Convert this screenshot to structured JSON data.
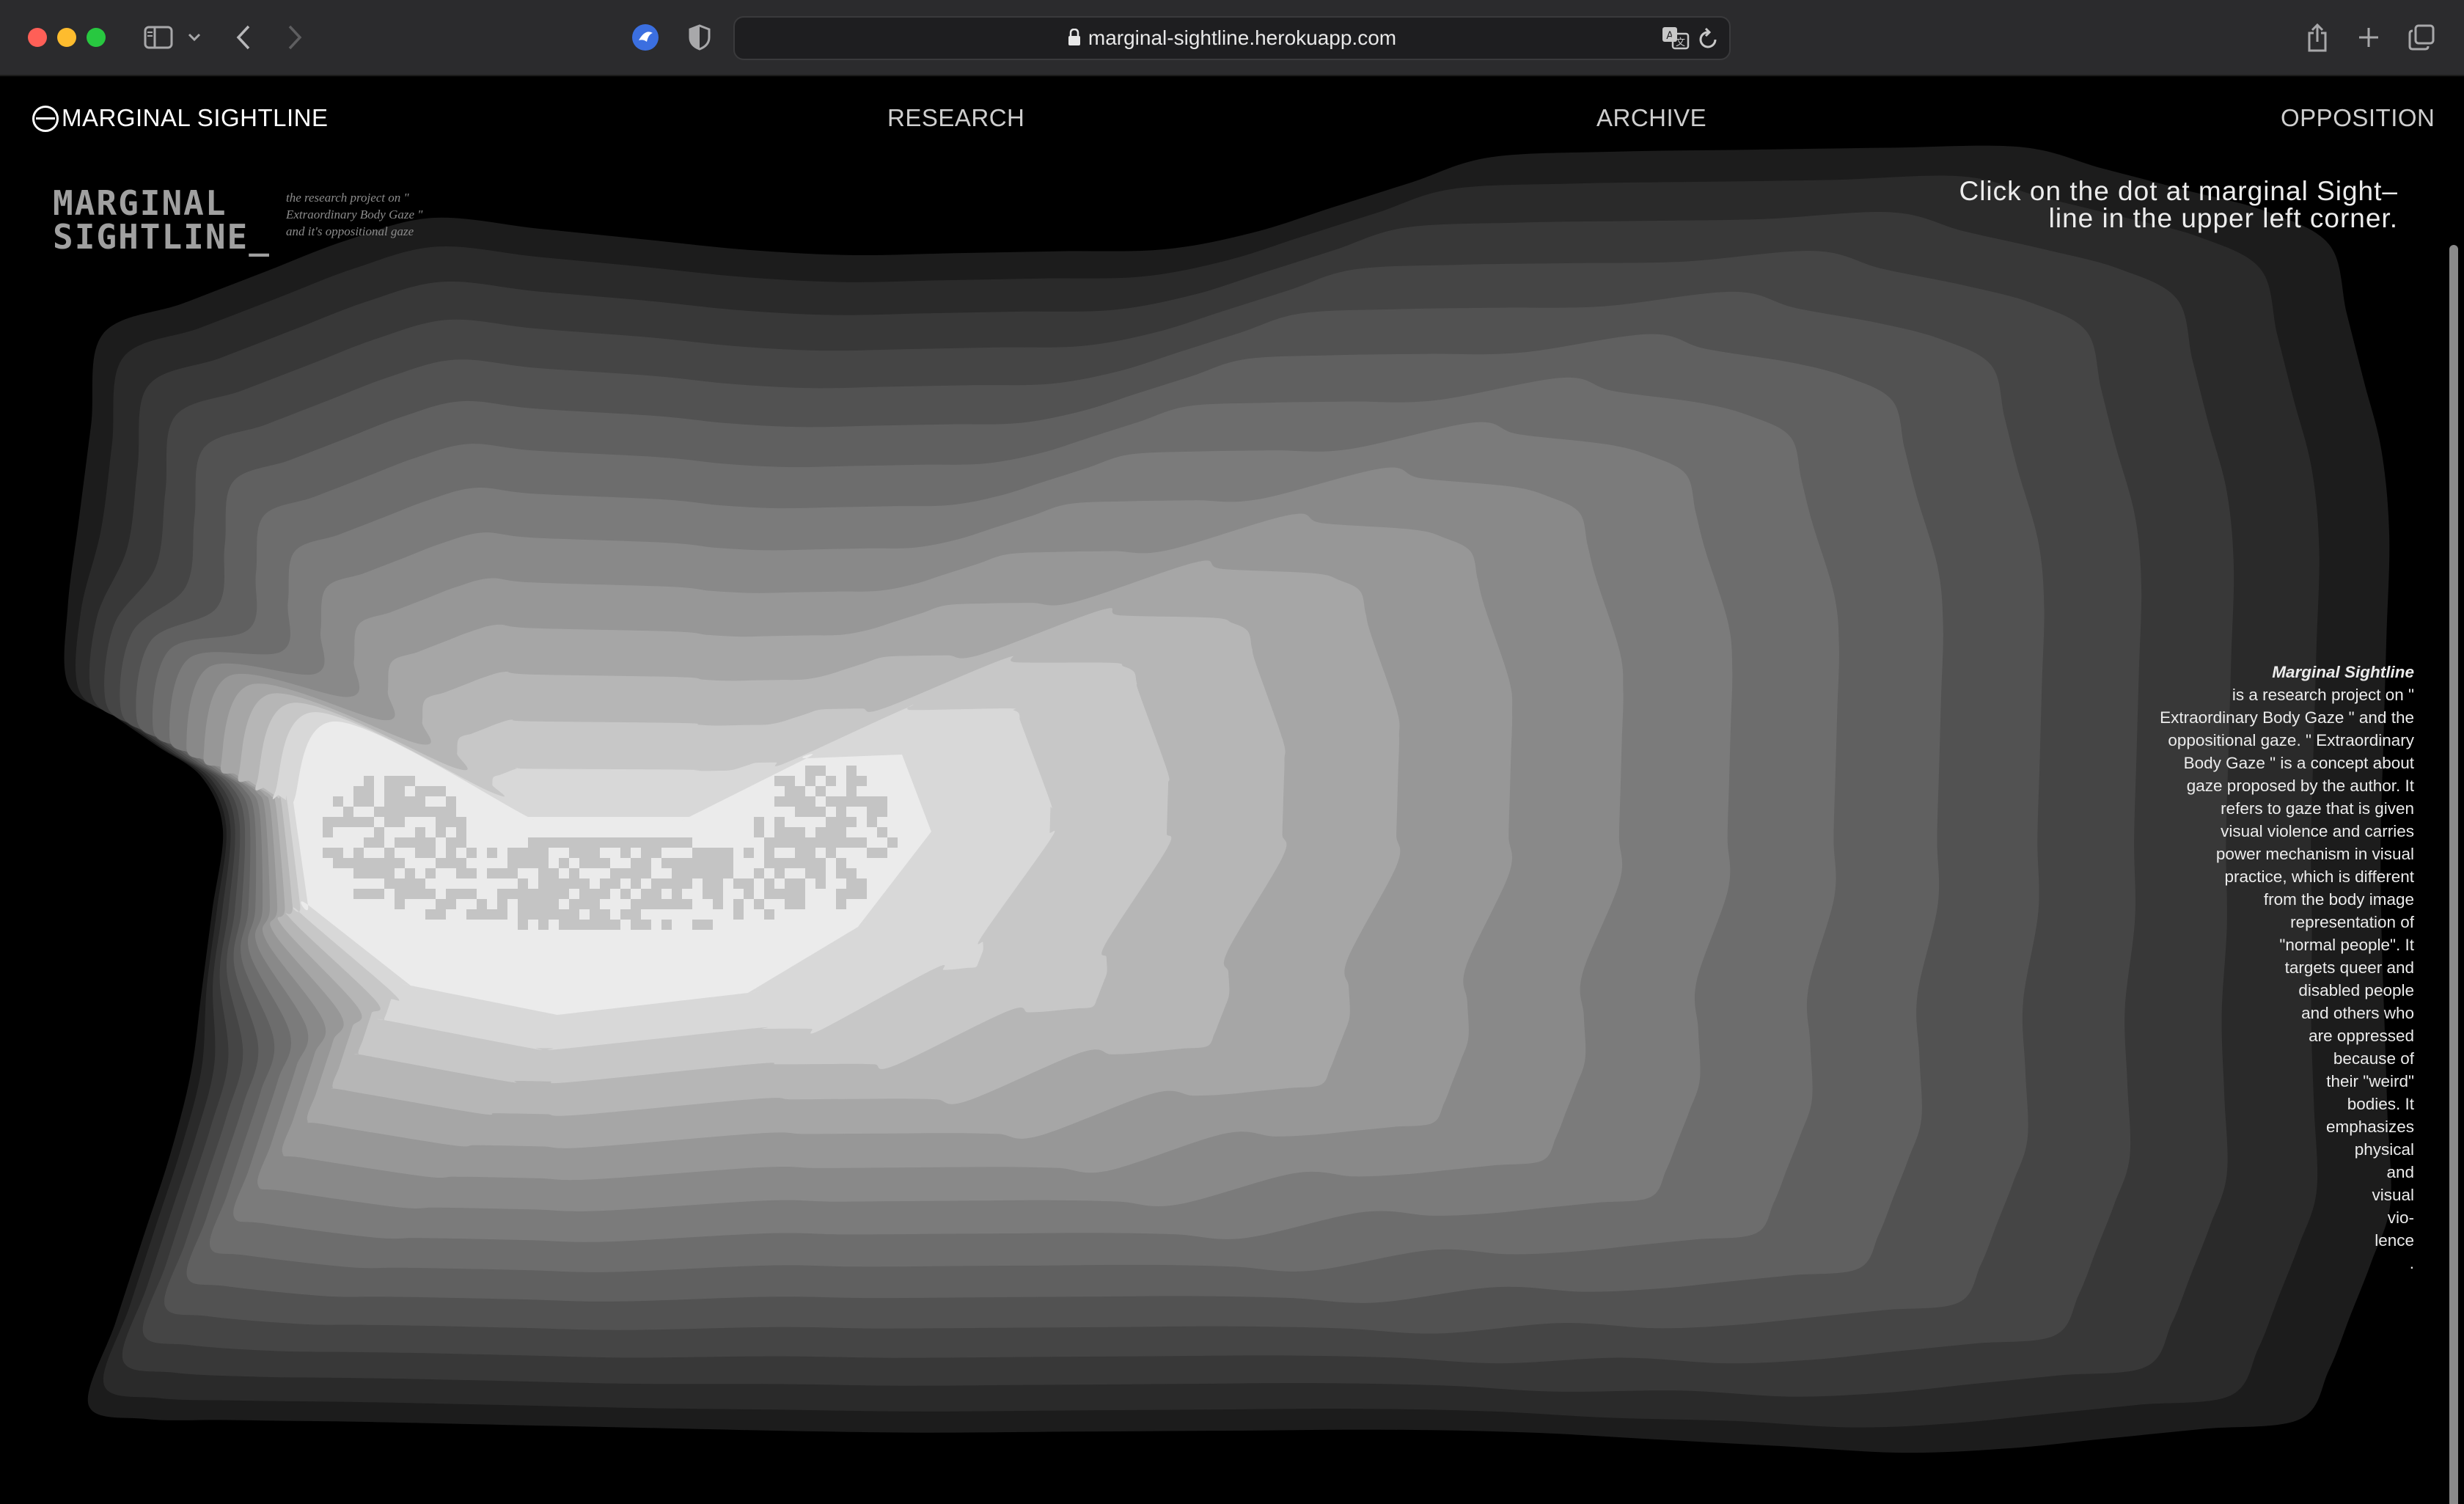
{
  "browser": {
    "url": "marginal-sightline.herokuapp.com",
    "icons": [
      "sidebar-icon",
      "chevron-down-icon",
      "back-icon",
      "forward-icon",
      "extension-icon",
      "shield-icon",
      "lock-icon",
      "translate-icon",
      "reload-icon",
      "share-icon",
      "new-tab-icon",
      "tabs-overview-icon"
    ]
  },
  "nav": {
    "brand": "MARGINAL SIGHTLINE",
    "research": "RESEARCH",
    "archive": "ARCHIVE",
    "opposition": "OPPOSITION"
  },
  "logo": {
    "line1": "MARGINAL",
    "line2": "SIGHTLINE_",
    "subtitle_lines": [
      "the research project on \"",
      "Extraordinary Body Gaze \"",
      "and it's oppositional gaze"
    ]
  },
  "hint": {
    "line1": "Click on the dot at marginal Sight–",
    "line2": "line in the upper left corner."
  },
  "description": {
    "title": "Marginal Sightline",
    "lines": [
      "is a research project on \"",
      "Extraordinary Body Gaze \" and the",
      "oppositional gaze. \" Extraordinary",
      "Body Gaze \" is a concept about",
      "gaze proposed by the author. It",
      "refers to gaze that is given",
      "visual violence and carries",
      "power mechanism in visual",
      "practice, which is different",
      "from the body image",
      "representation of",
      "\"normal people\". It",
      "targets queer and",
      "disabled people",
      "and others who",
      "are oppressed",
      "because of",
      "their \"weird\"",
      "bodies. It",
      "emphasizes",
      "physical",
      "and",
      "visual",
      "vio-",
      "lence",
      "."
    ]
  },
  "colors": {
    "background": "#000000",
    "topo_levels": [
      "#1c1c1c",
      "#2a2a2a",
      "#383838",
      "#454545",
      "#525252",
      "#606060",
      "#6d6d6d",
      "#7b7b7b",
      "#898989",
      "#979797",
      "#a6a6a6",
      "#b6b6b6",
      "#c7c7c7",
      "#d8d8d8",
      "#ebebeb"
    ],
    "pixel_mark": "#c4c4c4"
  }
}
